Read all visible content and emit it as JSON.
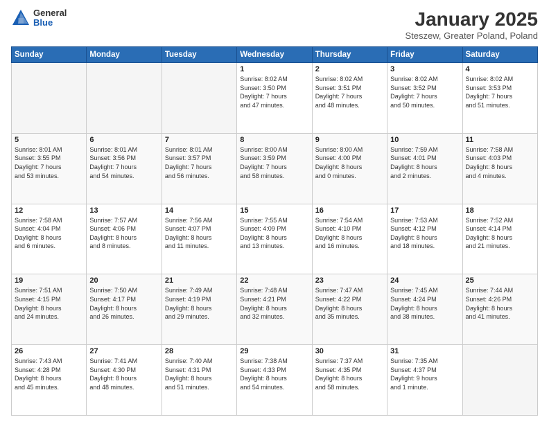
{
  "logo": {
    "general": "General",
    "blue": "Blue"
  },
  "header": {
    "title": "January 2025",
    "subtitle": "Steszew, Greater Poland, Poland"
  },
  "weekdays": [
    "Sunday",
    "Monday",
    "Tuesday",
    "Wednesday",
    "Thursday",
    "Friday",
    "Saturday"
  ],
  "weeks": [
    [
      {
        "day": "",
        "info": ""
      },
      {
        "day": "",
        "info": ""
      },
      {
        "day": "",
        "info": ""
      },
      {
        "day": "1",
        "info": "Sunrise: 8:02 AM\nSunset: 3:50 PM\nDaylight: 7 hours\nand 47 minutes."
      },
      {
        "day": "2",
        "info": "Sunrise: 8:02 AM\nSunset: 3:51 PM\nDaylight: 7 hours\nand 48 minutes."
      },
      {
        "day": "3",
        "info": "Sunrise: 8:02 AM\nSunset: 3:52 PM\nDaylight: 7 hours\nand 50 minutes."
      },
      {
        "day": "4",
        "info": "Sunrise: 8:02 AM\nSunset: 3:53 PM\nDaylight: 7 hours\nand 51 minutes."
      }
    ],
    [
      {
        "day": "5",
        "info": "Sunrise: 8:01 AM\nSunset: 3:55 PM\nDaylight: 7 hours\nand 53 minutes."
      },
      {
        "day": "6",
        "info": "Sunrise: 8:01 AM\nSunset: 3:56 PM\nDaylight: 7 hours\nand 54 minutes."
      },
      {
        "day": "7",
        "info": "Sunrise: 8:01 AM\nSunset: 3:57 PM\nDaylight: 7 hours\nand 56 minutes."
      },
      {
        "day": "8",
        "info": "Sunrise: 8:00 AM\nSunset: 3:59 PM\nDaylight: 7 hours\nand 58 minutes."
      },
      {
        "day": "9",
        "info": "Sunrise: 8:00 AM\nSunset: 4:00 PM\nDaylight: 8 hours\nand 0 minutes."
      },
      {
        "day": "10",
        "info": "Sunrise: 7:59 AM\nSunset: 4:01 PM\nDaylight: 8 hours\nand 2 minutes."
      },
      {
        "day": "11",
        "info": "Sunrise: 7:58 AM\nSunset: 4:03 PM\nDaylight: 8 hours\nand 4 minutes."
      }
    ],
    [
      {
        "day": "12",
        "info": "Sunrise: 7:58 AM\nSunset: 4:04 PM\nDaylight: 8 hours\nand 6 minutes."
      },
      {
        "day": "13",
        "info": "Sunrise: 7:57 AM\nSunset: 4:06 PM\nDaylight: 8 hours\nand 8 minutes."
      },
      {
        "day": "14",
        "info": "Sunrise: 7:56 AM\nSunset: 4:07 PM\nDaylight: 8 hours\nand 11 minutes."
      },
      {
        "day": "15",
        "info": "Sunrise: 7:55 AM\nSunset: 4:09 PM\nDaylight: 8 hours\nand 13 minutes."
      },
      {
        "day": "16",
        "info": "Sunrise: 7:54 AM\nSunset: 4:10 PM\nDaylight: 8 hours\nand 16 minutes."
      },
      {
        "day": "17",
        "info": "Sunrise: 7:53 AM\nSunset: 4:12 PM\nDaylight: 8 hours\nand 18 minutes."
      },
      {
        "day": "18",
        "info": "Sunrise: 7:52 AM\nSunset: 4:14 PM\nDaylight: 8 hours\nand 21 minutes."
      }
    ],
    [
      {
        "day": "19",
        "info": "Sunrise: 7:51 AM\nSunset: 4:15 PM\nDaylight: 8 hours\nand 24 minutes."
      },
      {
        "day": "20",
        "info": "Sunrise: 7:50 AM\nSunset: 4:17 PM\nDaylight: 8 hours\nand 26 minutes."
      },
      {
        "day": "21",
        "info": "Sunrise: 7:49 AM\nSunset: 4:19 PM\nDaylight: 8 hours\nand 29 minutes."
      },
      {
        "day": "22",
        "info": "Sunrise: 7:48 AM\nSunset: 4:21 PM\nDaylight: 8 hours\nand 32 minutes."
      },
      {
        "day": "23",
        "info": "Sunrise: 7:47 AM\nSunset: 4:22 PM\nDaylight: 8 hours\nand 35 minutes."
      },
      {
        "day": "24",
        "info": "Sunrise: 7:45 AM\nSunset: 4:24 PM\nDaylight: 8 hours\nand 38 minutes."
      },
      {
        "day": "25",
        "info": "Sunrise: 7:44 AM\nSunset: 4:26 PM\nDaylight: 8 hours\nand 41 minutes."
      }
    ],
    [
      {
        "day": "26",
        "info": "Sunrise: 7:43 AM\nSunset: 4:28 PM\nDaylight: 8 hours\nand 45 minutes."
      },
      {
        "day": "27",
        "info": "Sunrise: 7:41 AM\nSunset: 4:30 PM\nDaylight: 8 hours\nand 48 minutes."
      },
      {
        "day": "28",
        "info": "Sunrise: 7:40 AM\nSunset: 4:31 PM\nDaylight: 8 hours\nand 51 minutes."
      },
      {
        "day": "29",
        "info": "Sunrise: 7:38 AM\nSunset: 4:33 PM\nDaylight: 8 hours\nand 54 minutes."
      },
      {
        "day": "30",
        "info": "Sunrise: 7:37 AM\nSunset: 4:35 PM\nDaylight: 8 hours\nand 58 minutes."
      },
      {
        "day": "31",
        "info": "Sunrise: 7:35 AM\nSunset: 4:37 PM\nDaylight: 9 hours\nand 1 minute."
      },
      {
        "day": "",
        "info": ""
      }
    ]
  ]
}
